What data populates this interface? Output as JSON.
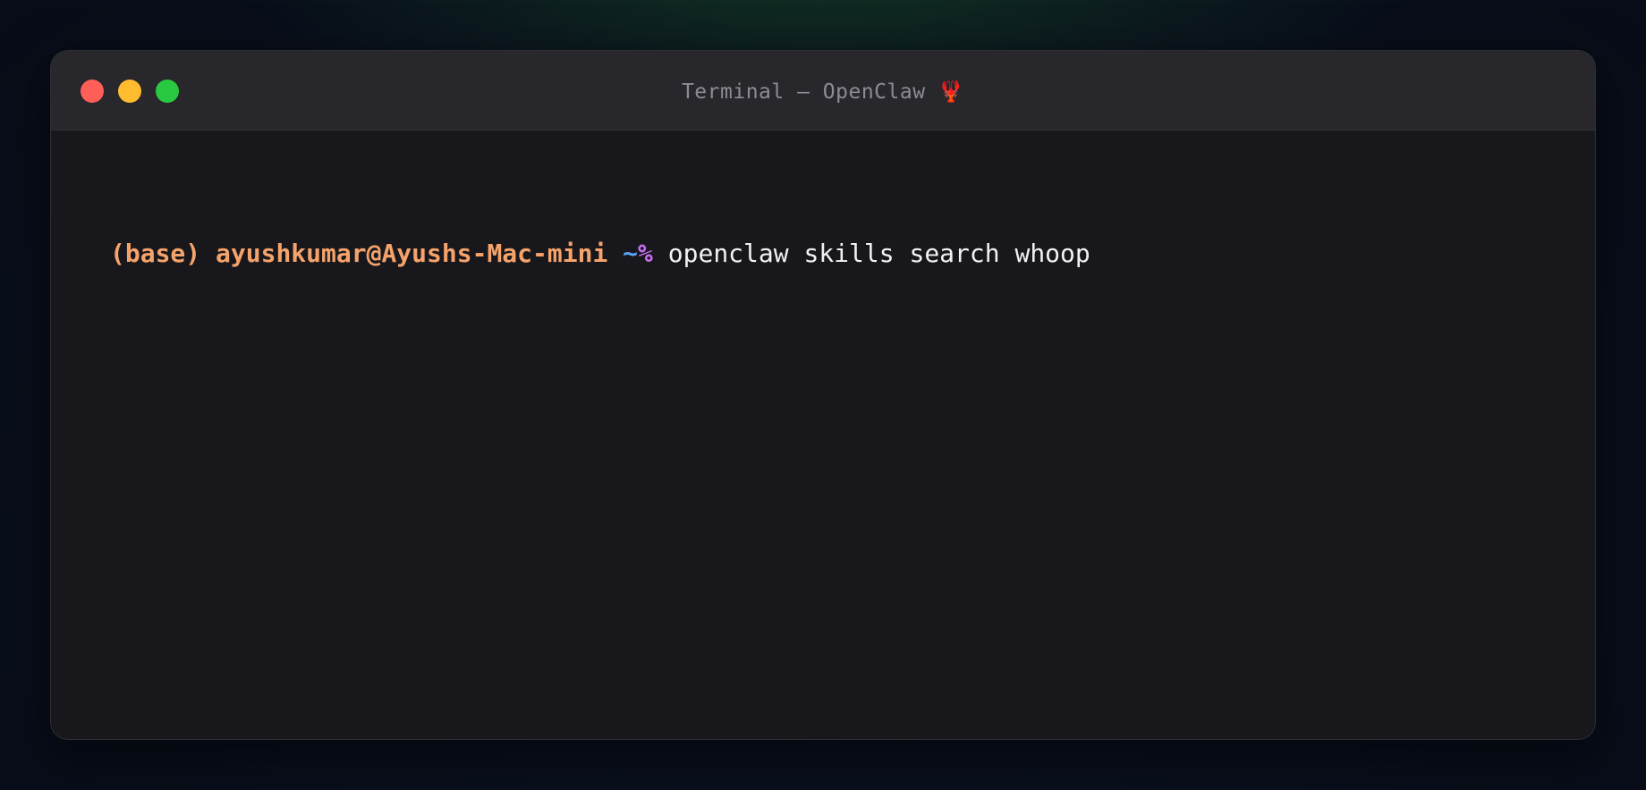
{
  "window": {
    "title": "Terminal — OpenClaw 🦞"
  },
  "terminal": {
    "env": "(base)",
    "user_host": "ayushkumar@Ayushs-Mac-mini",
    "cwd": "~",
    "prompt_symbol": "%",
    "command": "openclaw skills search whoop"
  },
  "colors": {
    "close": "#ff5f57",
    "minimize": "#febc2e",
    "zoom": "#28c840",
    "prompt": "#f5a36b",
    "cwd": "#5aa4f5",
    "prompt_symbol": "#c86cf0",
    "command": "#f2f2f4"
  }
}
